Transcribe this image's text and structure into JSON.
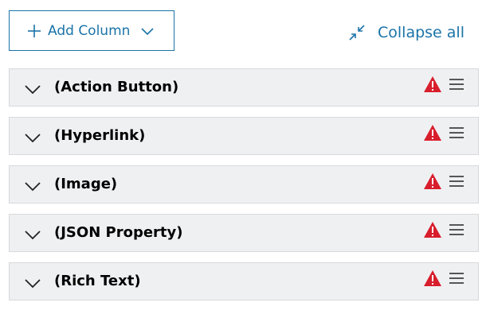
{
  "toolbar": {
    "add_column_label": "Add Column",
    "add_column_icon": "plus-icon",
    "add_column_dropdown_icon": "chevron-down-icon",
    "collapse_all_label": "Collapse all",
    "collapse_all_icon": "collapse-arrows-icon",
    "accent_color": "#1a73a8"
  },
  "columns": [
    {
      "label": "(Action Button)",
      "warning_icon": "warning-icon",
      "menu_icon": "drag-handle-icon",
      "expand_icon": "chevron-down-icon"
    },
    {
      "label": " (Hyperlink)",
      "warning_icon": "warning-icon",
      "menu_icon": "drag-handle-icon",
      "expand_icon": "chevron-down-icon"
    },
    {
      "label": " (Image)",
      "warning_icon": "warning-icon",
      "menu_icon": "drag-handle-icon",
      "expand_icon": "chevron-down-icon"
    },
    {
      "label": "(JSON Property)",
      "warning_icon": "warning-icon",
      "menu_icon": "drag-handle-icon",
      "expand_icon": "chevron-down-icon"
    },
    {
      "label": "(Rich Text)",
      "warning_icon": "warning-icon",
      "menu_icon": "drag-handle-icon",
      "expand_icon": "chevron-down-icon"
    }
  ],
  "colors": {
    "warning": "#d81e2c",
    "row_background": "#eff0f2",
    "row_border": "#d8d9db"
  }
}
